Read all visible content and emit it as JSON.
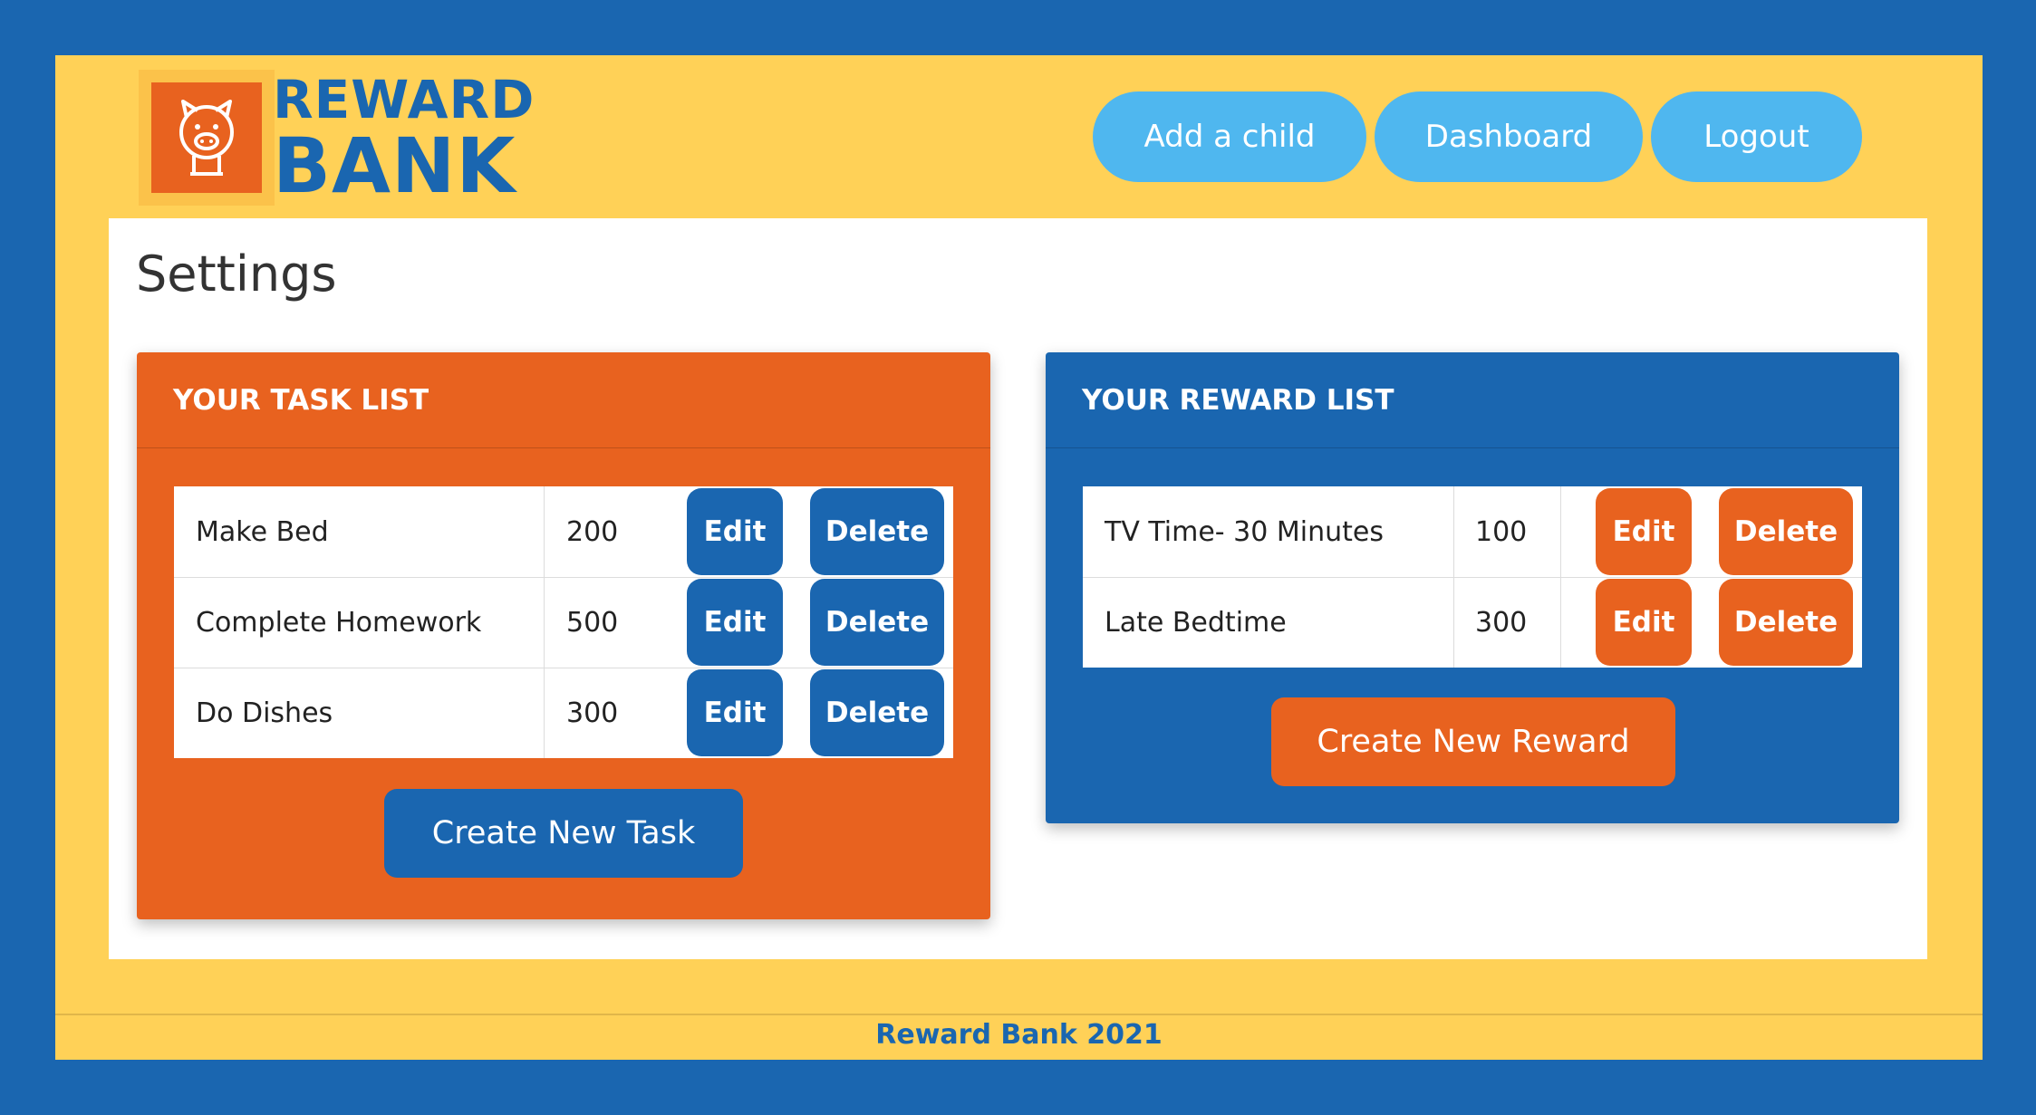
{
  "brand": {
    "line1": "REWARD",
    "line2": "BANK",
    "icon": "piggy-bank-icon"
  },
  "nav": {
    "add_child": "Add a child",
    "dashboard": "Dashboard",
    "logout": "Logout"
  },
  "page": {
    "title": "Settings"
  },
  "tasks": {
    "header": "YOUR TASK LIST",
    "rows": [
      {
        "name": "Make Bed",
        "points": "200",
        "edit": "Edit",
        "delete": "Delete"
      },
      {
        "name": "Complete Homework",
        "points": "500",
        "edit": "Edit",
        "delete": "Delete"
      },
      {
        "name": "Do Dishes",
        "points": "300",
        "edit": "Edit",
        "delete": "Delete"
      }
    ],
    "create_label": "Create New Task"
  },
  "rewards": {
    "header": "YOUR REWARD LIST",
    "rows": [
      {
        "name": "TV Time- 30 Minutes",
        "points": "100",
        "edit": "Edit",
        "delete": "Delete"
      },
      {
        "name": "Late Bedtime",
        "points": "300",
        "edit": "Edit",
        "delete": "Delete"
      }
    ],
    "create_label": "Create New Reward"
  },
  "footer": {
    "text": "Reward Bank 2021"
  },
  "colors": {
    "page_background": "#1a66b0",
    "frame_background": "#ffd157",
    "nav_button": "#4fb7ef",
    "orange": "#e8621f",
    "blue": "#1a66b0",
    "card_white": "#ffffff"
  }
}
